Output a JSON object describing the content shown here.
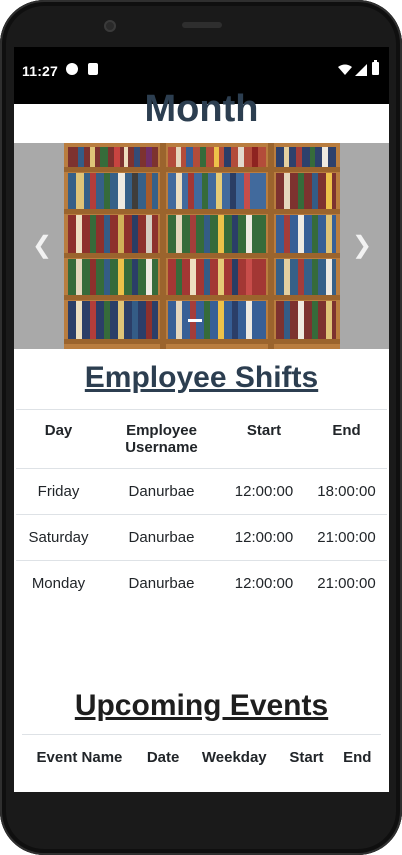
{
  "status_bar": {
    "time": "11:27"
  },
  "page": {
    "month_heading": "Month"
  },
  "carousel": {
    "prev_symbol": "❮",
    "next_symbol": "❯",
    "indicators": [
      {
        "active": true
      }
    ]
  },
  "employee_shifts": {
    "title": "Employee Shifts",
    "headers": [
      "Day",
      "Employee Username",
      "Start",
      "End"
    ],
    "rows": [
      [
        "Friday",
        "Danurbae",
        "12:00:00",
        "18:00:00"
      ],
      [
        "Saturday",
        "Danurbae",
        "12:00:00",
        "21:00:00"
      ],
      [
        "Monday",
        "Danurbae",
        "12:00:00",
        "21:00:00"
      ]
    ]
  },
  "upcoming_events": {
    "title": "Upcoming Events",
    "headers": [
      "Event Name",
      "Date",
      "Weekday",
      "Start",
      "End"
    ]
  },
  "colors": {
    "heading": "#2c3e50",
    "carousel_bg": "#a9a9a9",
    "status_bar_bg": "#000000"
  }
}
